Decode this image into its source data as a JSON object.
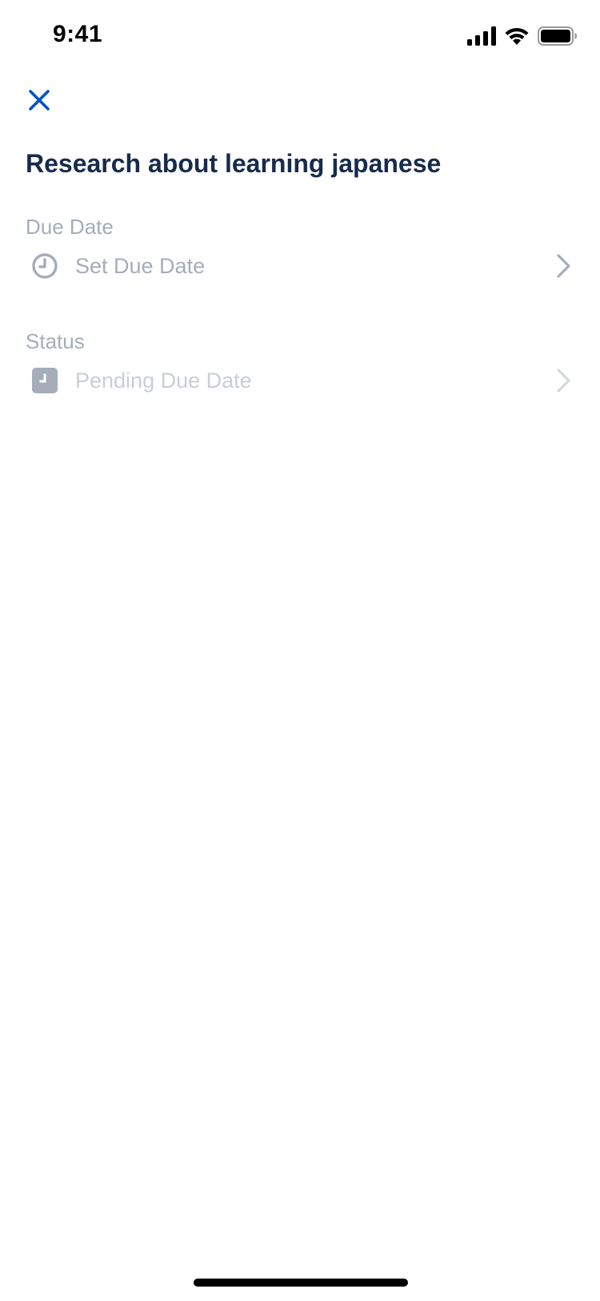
{
  "status_bar": {
    "time": "9:41"
  },
  "header": {
    "close_icon": "close-icon",
    "title": "Research about learning japanese"
  },
  "due_date": {
    "label": "Due Date",
    "value": "Set Due Date",
    "icon": "clock-icon"
  },
  "status": {
    "label": "Status",
    "value": "Pending Due Date",
    "icon": "pending-clock-square-icon"
  },
  "colors": {
    "accent": "#0052CC",
    "title": "#172B4D",
    "muted_label": "#A5ADBA",
    "muted_value": "#A5ADBA",
    "disabled_value": "#C9CED6"
  }
}
